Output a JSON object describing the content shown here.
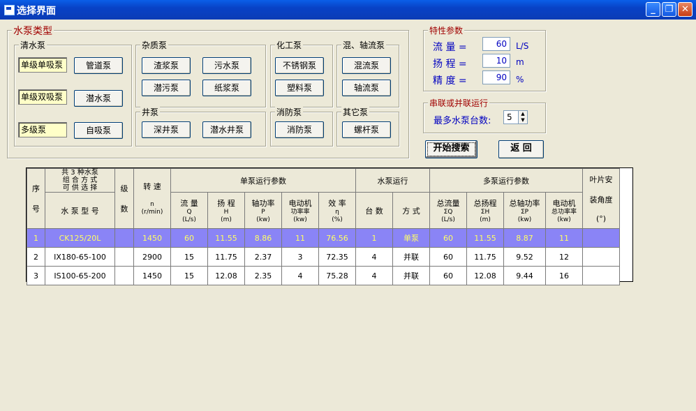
{
  "window": {
    "title": "选择界面"
  },
  "pump_type": {
    "legend": "水泵类型",
    "clear_water": {
      "legend": "清水泵",
      "labels": [
        "单级单吸泵",
        "单级双吸泵",
        "多级泵"
      ],
      "buttons": [
        "管道泵",
        "潜水泵",
        "自吸泵"
      ]
    },
    "impurity": {
      "legend": "杂质泵",
      "buttons": [
        "渣浆泵",
        "污水泵",
        "潜污泵",
        "纸浆泵"
      ]
    },
    "chemical": {
      "legend": "化工泵",
      "buttons": [
        "不锈钢泵",
        "塑料泵"
      ]
    },
    "mixed_axial": {
      "legend": "混、轴流泵",
      "buttons": [
        "混流泵",
        "轴流泵"
      ]
    },
    "well": {
      "legend": "井泵",
      "buttons": [
        "深井泵",
        "潜水井泵"
      ]
    },
    "fire": {
      "legend": "消防泵",
      "buttons": [
        "消防泵"
      ]
    },
    "other": {
      "legend": "其它泵",
      "buttons": [
        "螺杆泵"
      ]
    }
  },
  "params": {
    "legend": "特性参数",
    "flow": {
      "label": "流  量 =",
      "value": "60",
      "unit": "L/S"
    },
    "head": {
      "label": "扬  程 =",
      "value": "10",
      "unit": "m"
    },
    "precision": {
      "label": "精  度 =",
      "value": "90",
      "unit": "%"
    }
  },
  "series": {
    "legend": "串联或并联运行",
    "label": "最多水泵台数:",
    "value": "5"
  },
  "actions": {
    "search": "开始搜索",
    "back": "返  回"
  },
  "table": {
    "h_seq": [
      "序",
      "号"
    ],
    "h_model_top": "共 3 种水泵\n组 合 方 式\n可 供 选 择",
    "h_model": "水 泵 型 号",
    "h_stage": [
      "级",
      "数"
    ],
    "h_speed": [
      "转  速",
      "n",
      "(r/min)"
    ],
    "h_single": "单泵运行参数",
    "h_pump_run": "水泵运行",
    "h_multi": "多泵运行参数",
    "h_blade": [
      "叶片安",
      "装角度",
      "(°)"
    ],
    "sub": [
      [
        "流  量",
        "Q",
        "(L/s)"
      ],
      [
        "扬  程",
        "H",
        "(m)"
      ],
      [
        "轴功率",
        "P",
        "(kw)"
      ],
      [
        "电动机",
        "功率率",
        "(kw)"
      ],
      [
        "效  率",
        "η",
        "(%)"
      ],
      [
        "台  数"
      ],
      [
        "方  式"
      ],
      [
        "总流量",
        "ΣQ",
        "(L/s)"
      ],
      [
        "总扬程",
        "ΣH",
        "(m)"
      ],
      [
        "总轴功率",
        "ΣP",
        "(kw)"
      ],
      [
        "电动机",
        "总功率率",
        "(kw)"
      ]
    ],
    "rows": [
      [
        "1",
        "CK125/20L",
        "",
        "1450",
        "60",
        "11.55",
        "8.86",
        "11",
        "76.56",
        "1",
        "单泵",
        "60",
        "11.55",
        "8.87",
        "11",
        ""
      ],
      [
        "2",
        "IX180-65-100",
        "",
        "2900",
        "15",
        "11.75",
        "2.37",
        "3",
        "72.35",
        "4",
        "并联",
        "60",
        "11.75",
        "9.52",
        "12",
        ""
      ],
      [
        "3",
        "IS100-65-200",
        "",
        "1450",
        "15",
        "12.08",
        "2.35",
        "4",
        "75.28",
        "4",
        "并联",
        "60",
        "12.08",
        "9.44",
        "16",
        ""
      ]
    ]
  }
}
